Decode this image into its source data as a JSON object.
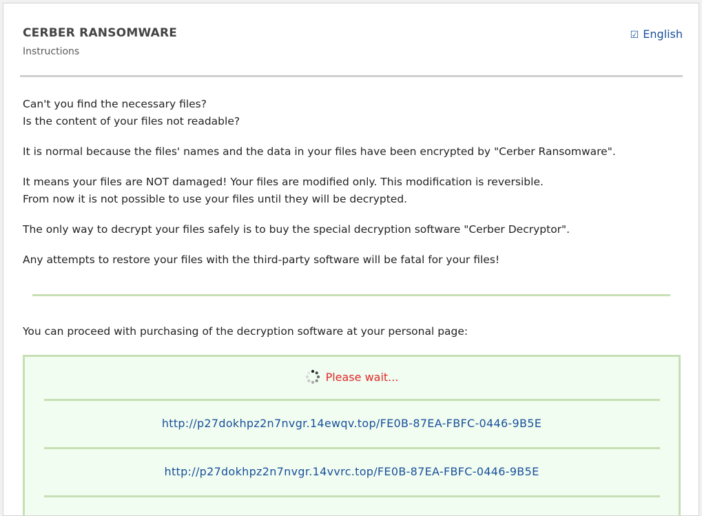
{
  "header": {
    "title": "CERBER RANSOMWARE",
    "subtitle": "Instructions",
    "language_checkbox": "☑",
    "language_label": "English"
  },
  "body": {
    "line1": "Can't you find the necessary files?",
    "line2": "Is the content of your files not readable?",
    "p2": "It is normal because the files' names and the data in your files have been encrypted by \"Cerber Ransomware\".",
    "p3_line1": "It means your files are NOT damaged! Your files are modified only. This modification is reversible.",
    "p3_line2": "From now it is not possible to use your files until they will be decrypted.",
    "p4": "The only way to decrypt your files safely is to buy the special decryption software \"Cerber Decryptor\".",
    "p5": "Any attempts to restore your files with the third-party software will be fatal for your files!"
  },
  "purchase": {
    "intro": "You can proceed with purchasing of the decryption software at your personal page:",
    "wait_text": "Please wait...",
    "links": [
      "http://p27dokhpz2n7nvgr.14ewqv.top/FE0B-87EA-FBFC-0446-9B5E",
      "http://p27dokhpz2n7nvgr.14vvrc.top/FE0B-87EA-FBFC-0446-9B5E"
    ]
  },
  "colors": {
    "accent_link": "#1a4f9c",
    "wait_red": "#e12828",
    "green_border": "#c6dfb4",
    "box_background": "#f0fdf0"
  },
  "icons": {
    "language": "checkbox-icon",
    "loading": "spinner-icon"
  }
}
